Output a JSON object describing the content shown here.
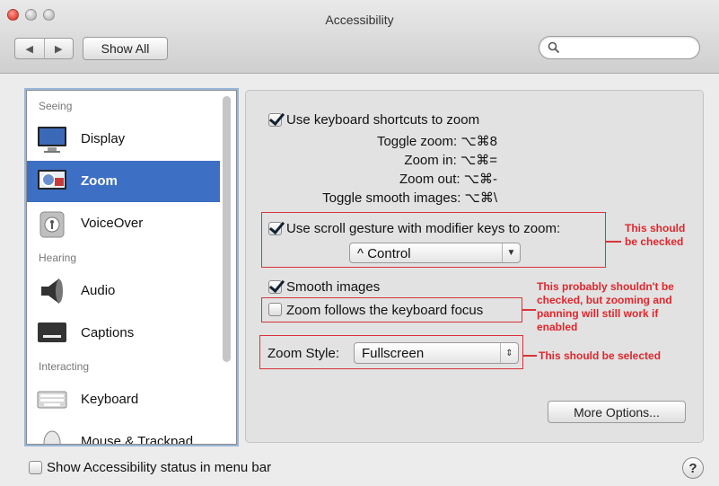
{
  "window": {
    "title": "Accessibility"
  },
  "toolbar": {
    "back_label": "◀",
    "forward_label": "▶",
    "show_all_label": "Show All",
    "search_placeholder": ""
  },
  "sidebar": {
    "sections": {
      "seeing": "Seeing",
      "hearing": "Hearing",
      "interacting": "Interacting"
    },
    "items": [
      {
        "label": "Display",
        "icon": "display-icon"
      },
      {
        "label": "Zoom",
        "icon": "zoom-icon",
        "selected": true
      },
      {
        "label": "VoiceOver",
        "icon": "voiceover-icon"
      },
      {
        "label": "Audio",
        "icon": "speaker-icon"
      },
      {
        "label": "Captions",
        "icon": "captions-icon"
      },
      {
        "label": "Keyboard",
        "icon": "keyboard-icon"
      },
      {
        "label": "Mouse & Trackpad",
        "icon": "mouse-icon"
      }
    ]
  },
  "zoom": {
    "keyboard_shortcuts": {
      "label": "Use keyboard shortcuts to zoom",
      "checked": true,
      "rows": [
        {
          "label": "Toggle zoom:",
          "keys": "⌥⌘8"
        },
        {
          "label": "Zoom in:",
          "keys": "⌥⌘="
        },
        {
          "label": "Zoom out:",
          "keys": "⌥⌘-"
        },
        {
          "label": "Toggle smooth images:",
          "keys": "⌥⌘\\"
        }
      ]
    },
    "scroll_gesture": {
      "label": "Use scroll gesture with modifier keys to zoom:",
      "checked": true,
      "modifier_value": "^ Control"
    },
    "smooth_images": {
      "label": "Smooth images",
      "checked": true
    },
    "follow_focus": {
      "label": "Zoom follows the keyboard focus",
      "checked": false
    },
    "zoom_style": {
      "label": "Zoom Style:",
      "value": "Fullscreen"
    },
    "more_options_label": "More Options..."
  },
  "annotations": {
    "scroll_note_1": "This should",
    "scroll_note_2": "be checked",
    "focus_note_1": "This probably shouldn't be",
    "focus_note_2": "checked, but zooming and",
    "focus_note_3": "panning will still work if",
    "focus_note_4": "enabled",
    "style_note": "This should be selected",
    "color": "#e0262c"
  },
  "footer": {
    "status_label": "Show Accessibility status in menu bar",
    "status_checked": false,
    "help_label": "?"
  }
}
